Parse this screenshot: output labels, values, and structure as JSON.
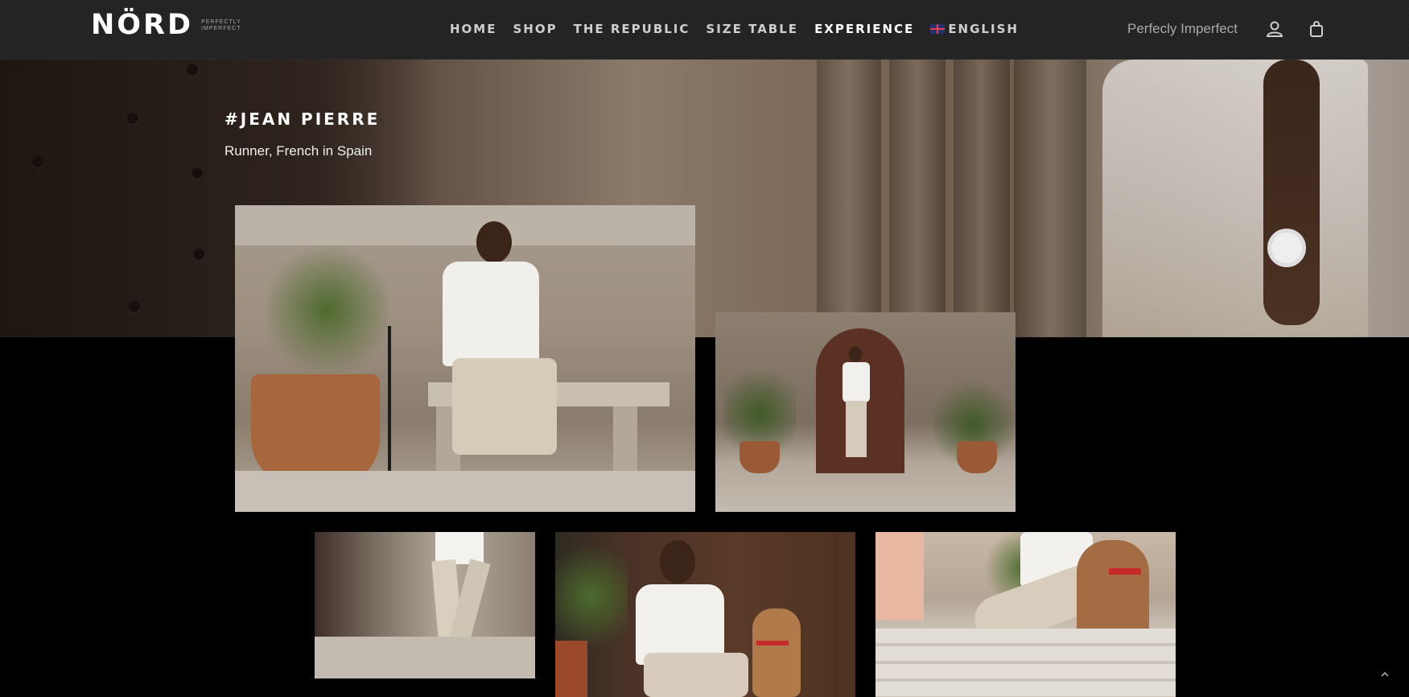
{
  "header": {
    "logo_text": "NÖRD",
    "logo_tagline": "PERFECTLY IMPERFECT",
    "nav": [
      {
        "label": "HOME"
      },
      {
        "label": "SHOP"
      },
      {
        "label": "THE REPUBLIC"
      },
      {
        "label": "SIZE TABLE"
      },
      {
        "label": "EXPERIENCE",
        "active": true
      },
      {
        "label": "ENGLISH",
        "flag": "uk-flag"
      }
    ],
    "tagline": "Perfecly Imperfect",
    "icons": [
      "account-icon",
      "shopping-bag-icon"
    ]
  },
  "hero": {
    "title": "#JEAN PIERRE",
    "subtitle": "Runner, French in Spain"
  },
  "gallery": [
    {
      "name": "photo-man-on-bench"
    },
    {
      "name": "photo-man-at-door"
    },
    {
      "name": "photo-walking-legs"
    },
    {
      "name": "photo-man-with-dog-crouching"
    },
    {
      "name": "photo-sitting-steps-with-dog"
    }
  ],
  "scroll_top_icon": "chevron-up-icon",
  "colors": {
    "header_bg": "#232323",
    "nav_text": "#cfcfcf",
    "active_nav": "#ffffff",
    "page_bg": "#000000"
  }
}
